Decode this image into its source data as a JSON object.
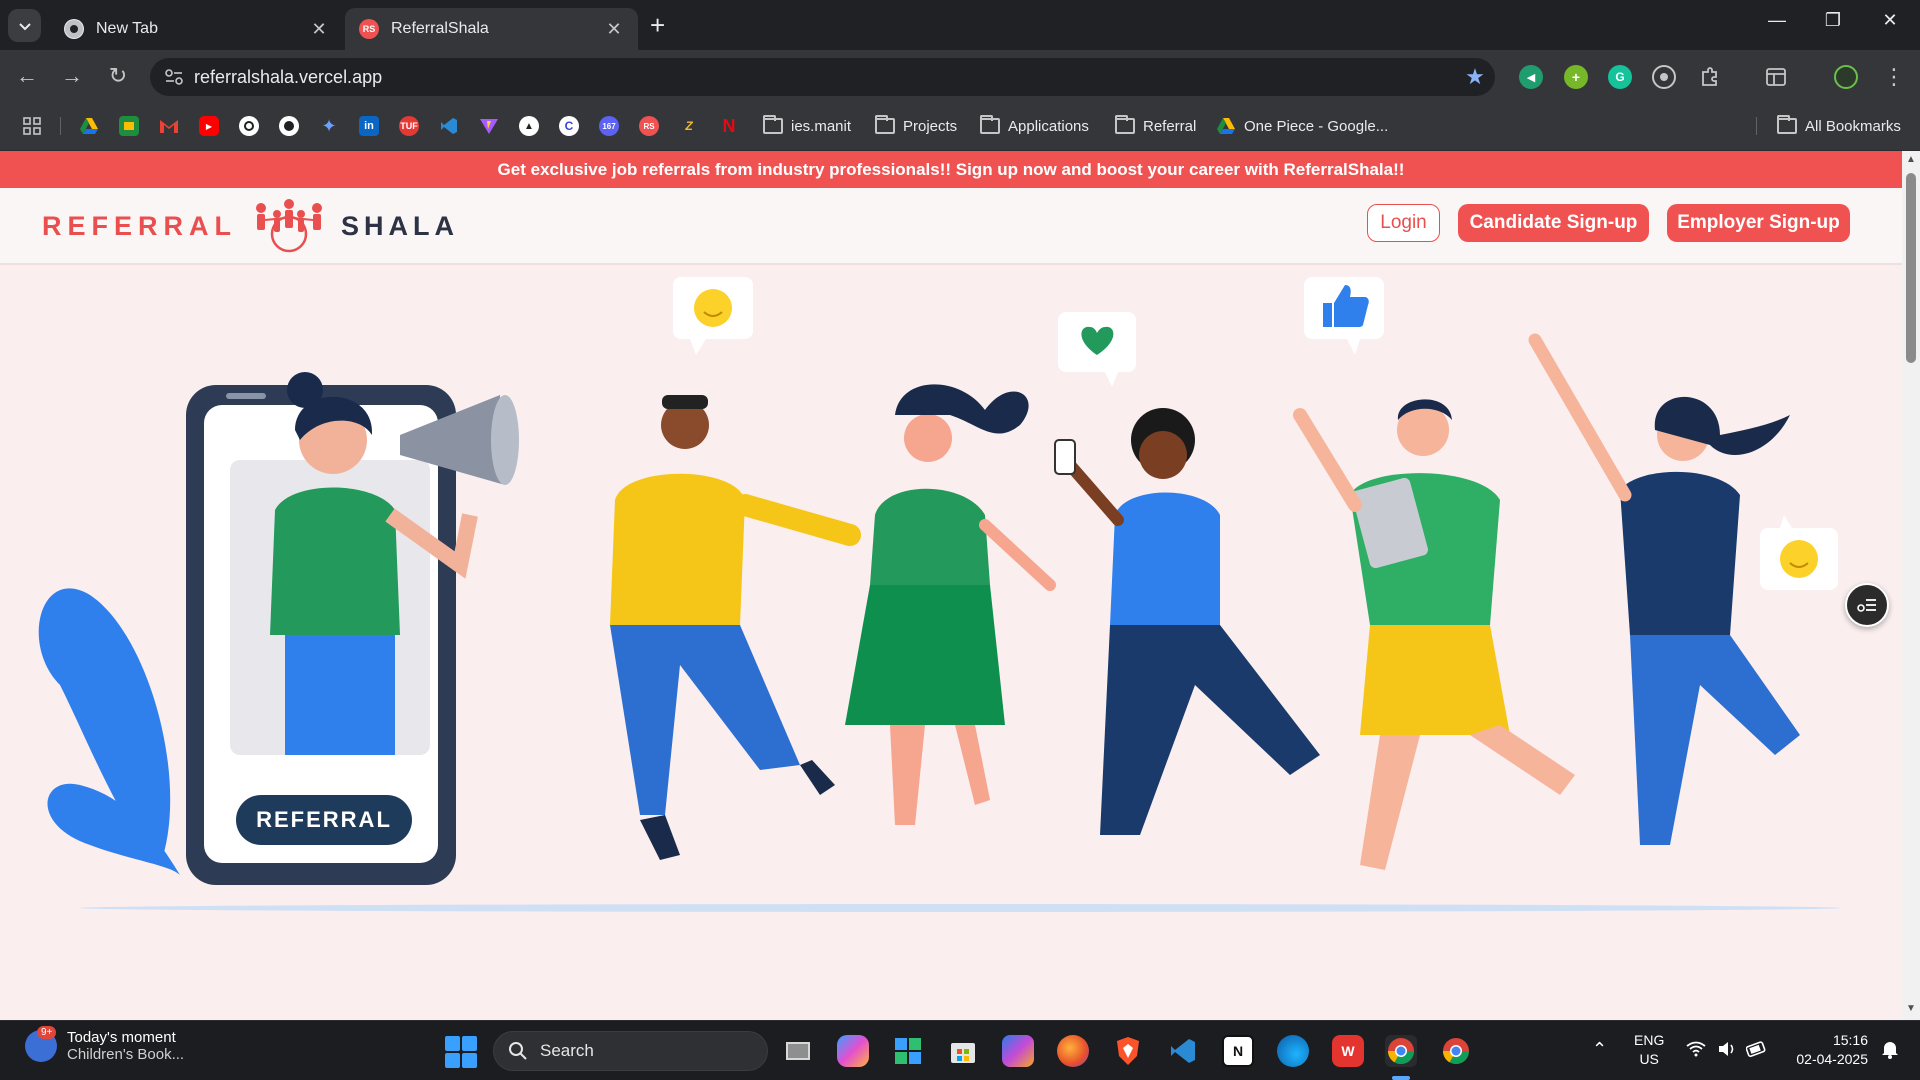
{
  "browser": {
    "tabs": [
      {
        "title": "New Tab",
        "favicon": "chrome-icon"
      },
      {
        "title": "ReferralShala",
        "favicon": "RS",
        "active": true
      }
    ],
    "url": "referralshala.vercel.app",
    "bookmarks": {
      "icon_apps": [
        "google-drive",
        "google-meet",
        "gmail",
        "youtube",
        "openai",
        "github",
        "gemini",
        "linkedin",
        "tuf",
        "vscode",
        "vite",
        "notion-black",
        "codechef",
        "leetcode-167",
        "RS",
        "zoho",
        "netflix"
      ],
      "tuf_label": "TUF",
      "lc_label": "167",
      "rs_label": "RS",
      "folders": [
        "ies.manit",
        "Projects",
        "Applications",
        "Referral"
      ],
      "drive_link": "One Piece - Google...",
      "all_bookmarks": "All Bookmarks"
    }
  },
  "page": {
    "announcement": "Get exclusive job referrals from industry professionals!! Sign up now and boost your career with ReferralShala!!",
    "logo": {
      "left": "REFERRAL",
      "right": "SHALA"
    },
    "nav": {
      "login": "Login",
      "candidate_signup": "Candidate Sign-up",
      "employer_signup": "Employer Sign-up"
    },
    "hero": {
      "phone_badge": "REFERRAL"
    },
    "colors": {
      "accent": "#f05252",
      "navy": "#1f3b5c",
      "page_bg": "#faeeee"
    }
  },
  "taskbar": {
    "widget": {
      "title": "Today's moment",
      "subtitle": "Children's Book...",
      "badge": "9+"
    },
    "search_placeholder": "Search",
    "apps": [
      "task-view",
      "copilot",
      "widgets",
      "microsoft-store",
      "microsoft-365",
      "firefox",
      "brave",
      "vscode",
      "notion",
      "edge",
      "wps-office",
      "chrome",
      "chrome-profile"
    ],
    "notion_label": "N",
    "wps_label": "W",
    "tray": {
      "lang": "ENG",
      "region": "US",
      "time": "15:16",
      "date": "02-04-2025"
    }
  }
}
